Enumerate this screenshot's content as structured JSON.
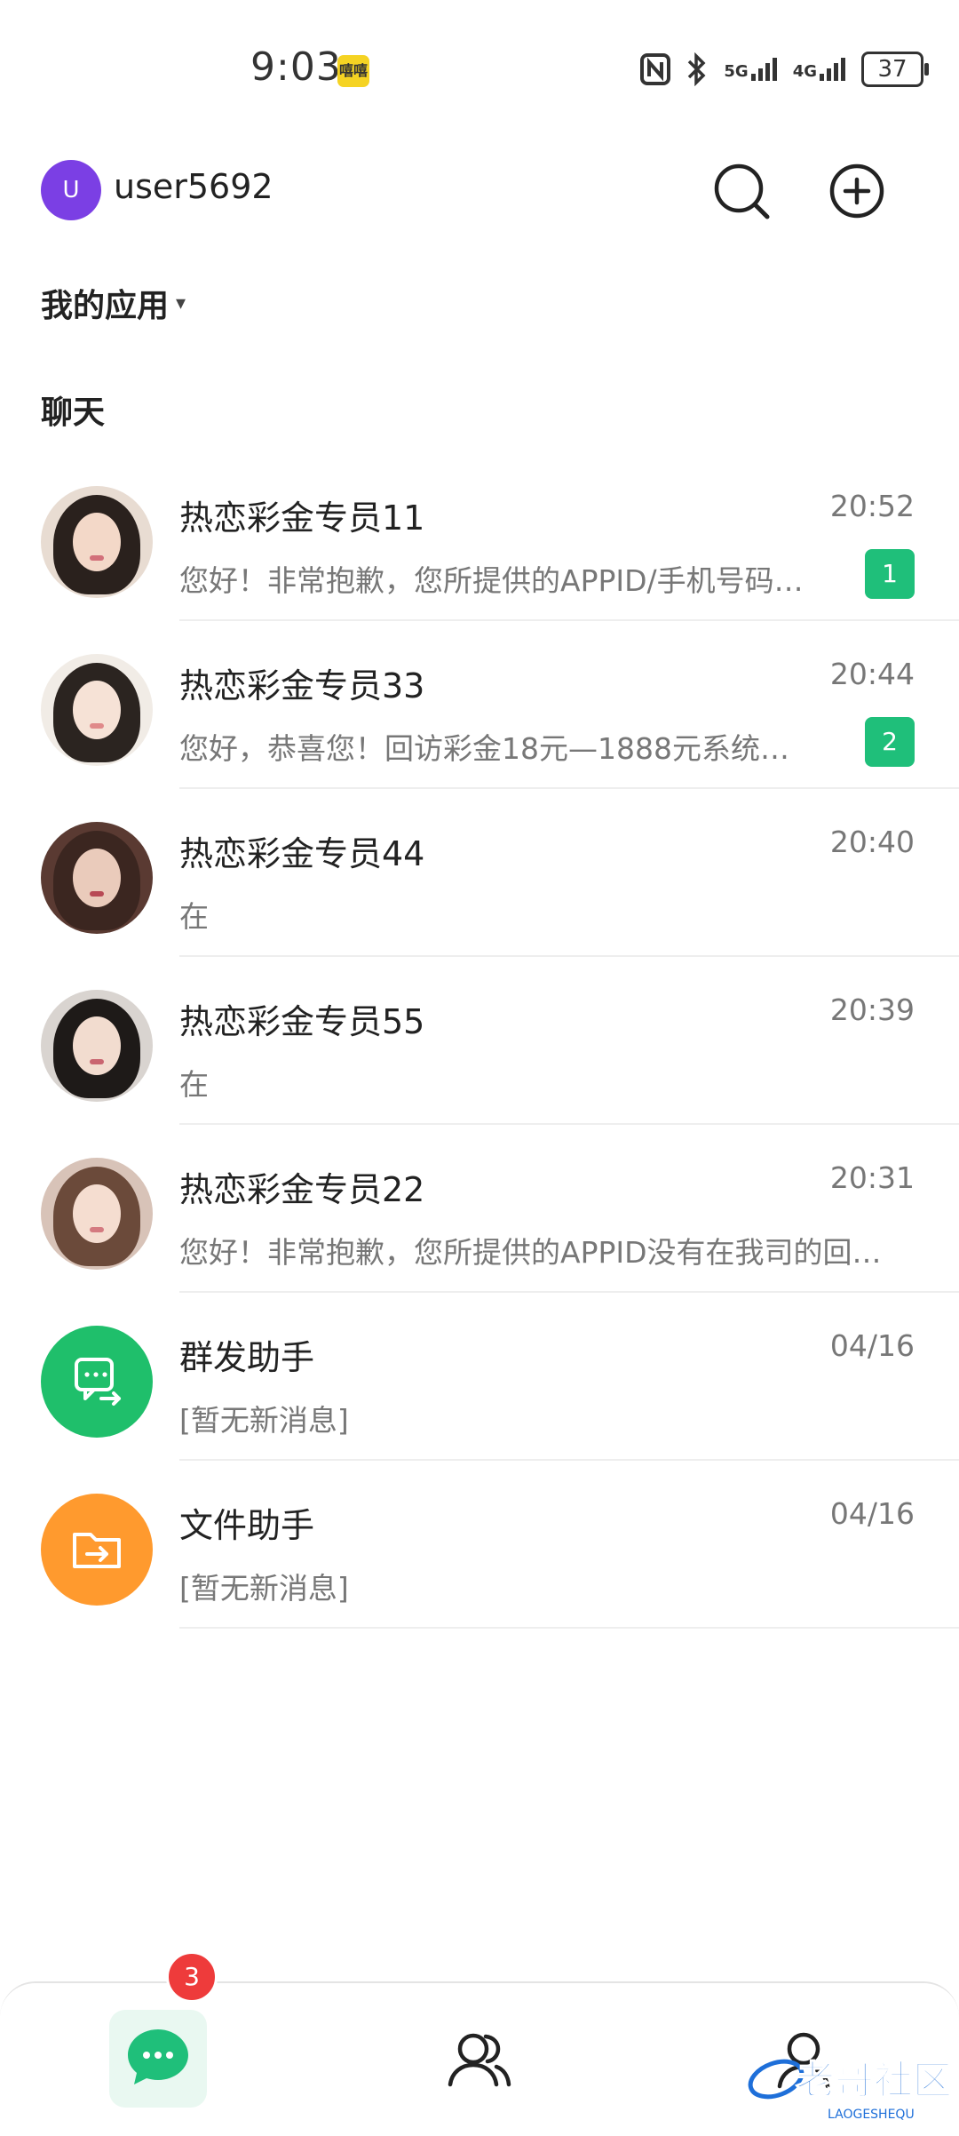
{
  "status_bar": {
    "time": "9:03",
    "app_badge": "嘻嘻",
    "network_1": "5G",
    "network_2": "4G",
    "battery": "37"
  },
  "header": {
    "avatar_letter": "U",
    "username": "user5692",
    "search_icon": "search-icon",
    "add_icon": "plus-circle-icon"
  },
  "my_apps": {
    "label": "我的应用",
    "caret": "▾"
  },
  "chat_section": {
    "title": "聊天"
  },
  "chats": [
    {
      "name": "热恋彩金专员11",
      "time": "20:52",
      "preview": "您好！非常抱歉，您所提供的APPID/手机号码…",
      "unread": "1",
      "avatar": "photo"
    },
    {
      "name": "热恋彩金专员33",
      "time": "20:44",
      "preview": "您好，恭喜您！回访彩金18元—1888元系统…",
      "unread": "2",
      "avatar": "photo"
    },
    {
      "name": "热恋彩金专员44",
      "time": "20:40",
      "preview": "在",
      "unread": "",
      "avatar": "photo"
    },
    {
      "name": "热恋彩金专员55",
      "time": "20:39",
      "preview": "在",
      "unread": "",
      "avatar": "photo"
    },
    {
      "name": "热恋彩金专员22",
      "time": "20:31",
      "preview": "您好！非常抱歉，您所提供的APPID没有在我司的回…",
      "unread": "",
      "avatar": "photo"
    },
    {
      "name": "群发助手",
      "time": "04/16",
      "preview": "[暂无新消息]",
      "unread": "",
      "avatar": "broadcast-icon",
      "color": "#1fbf6b"
    },
    {
      "name": "文件助手",
      "time": "04/16",
      "preview": "[暂无新消息]",
      "unread": "",
      "avatar": "folder-icon",
      "color": "#ff9a2e"
    }
  ],
  "tabbar": {
    "chats_badge": "3",
    "chats_icon": "chat-bubble-icon",
    "contacts_icon": "contacts-icon",
    "me_icon": "person-icon",
    "active_color": "#1fbf7a"
  },
  "watermark": {
    "text": "老哥社区",
    "subtext": "LAOGESHEQU"
  }
}
